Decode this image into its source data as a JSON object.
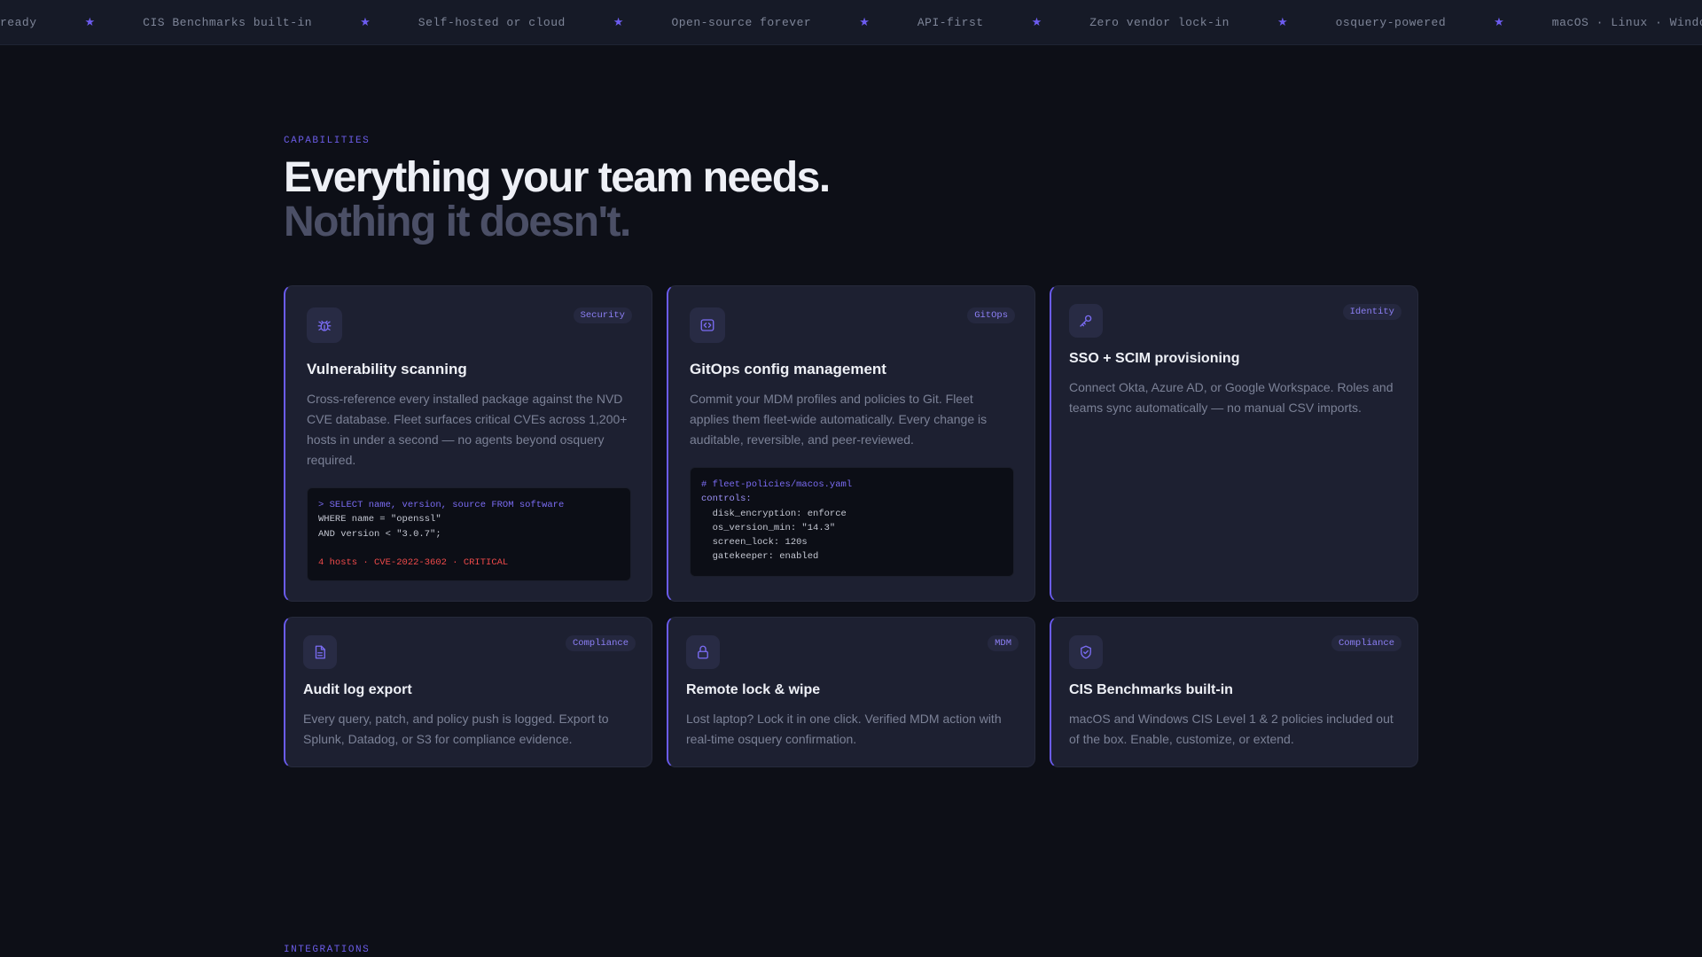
{
  "ticker": {
    "items": [
      "ready",
      "CIS Benchmarks built-in",
      "Self-hosted or cloud",
      "Open-source forever",
      "API-first",
      "Zero vendor lock-in",
      "osquery-powered",
      "macOS · Linux · Windows · Android"
    ],
    "separator": "★"
  },
  "capabilities": {
    "eyebrow": "CAPABILITIES",
    "headline_line1": "Everything your team needs.",
    "headline_line2": "Nothing it doesn't."
  },
  "cards": [
    {
      "tag": "Security",
      "icon": "bug-icon",
      "title": "Vulnerability scanning",
      "description": "Cross-reference every installed package against the NVD CVE database. Fleet surfaces critical CVEs across 1,200+ hosts in under a second — no agents beyond osquery required.",
      "code": {
        "line1": "> SELECT name, version, source FROM software",
        "line2": "WHERE name = \"openssl\"",
        "line3": "AND version < \"3.0.7\";",
        "result": "4 hosts · CVE-2022-3602 · CRITICAL"
      }
    },
    {
      "tag": "GitOps",
      "icon": "code-icon",
      "title": "GitOps config management",
      "description": "Commit your MDM profiles and policies to Git. Fleet applies them fleet-wide automatically. Every change is auditable, reversible, and peer-reviewed.",
      "code": {
        "comment": "# fleet-policies/macos.yaml",
        "key": "controls:",
        "line1": "  disk_encryption: enforce",
        "line2": "  os_version_min: \"14.3\"",
        "line3": "  screen_lock: 120s",
        "line4": "  gatekeeper: enabled"
      }
    },
    {
      "tag": "Identity",
      "icon": "key-icon",
      "title": "SSO + SCIM provisioning",
      "description": "Connect Okta, Azure AD, or Google Workspace. Roles and teams sync automatically — no manual CSV imports."
    },
    {
      "tag": "Compliance",
      "icon": "document-icon",
      "title": "Audit log export",
      "description": "Every query, patch, and policy push is logged. Export to Splunk, Datadog, or S3 for compliance evidence."
    },
    {
      "tag": "MDM",
      "icon": "lock-icon",
      "title": "Remote lock & wipe",
      "description": "Lost laptop? Lock it in one click. Verified MDM action with real-time osquery confirmation."
    },
    {
      "tag": "Compliance",
      "icon": "shield-check-icon",
      "title": "CIS Benchmarks built-in",
      "description": "macOS and Windows CIS Level 1 & 2 policies included out of the box. Enable, customize, or extend."
    }
  ],
  "integrations": {
    "eyebrow": "INTEGRATIONS"
  }
}
